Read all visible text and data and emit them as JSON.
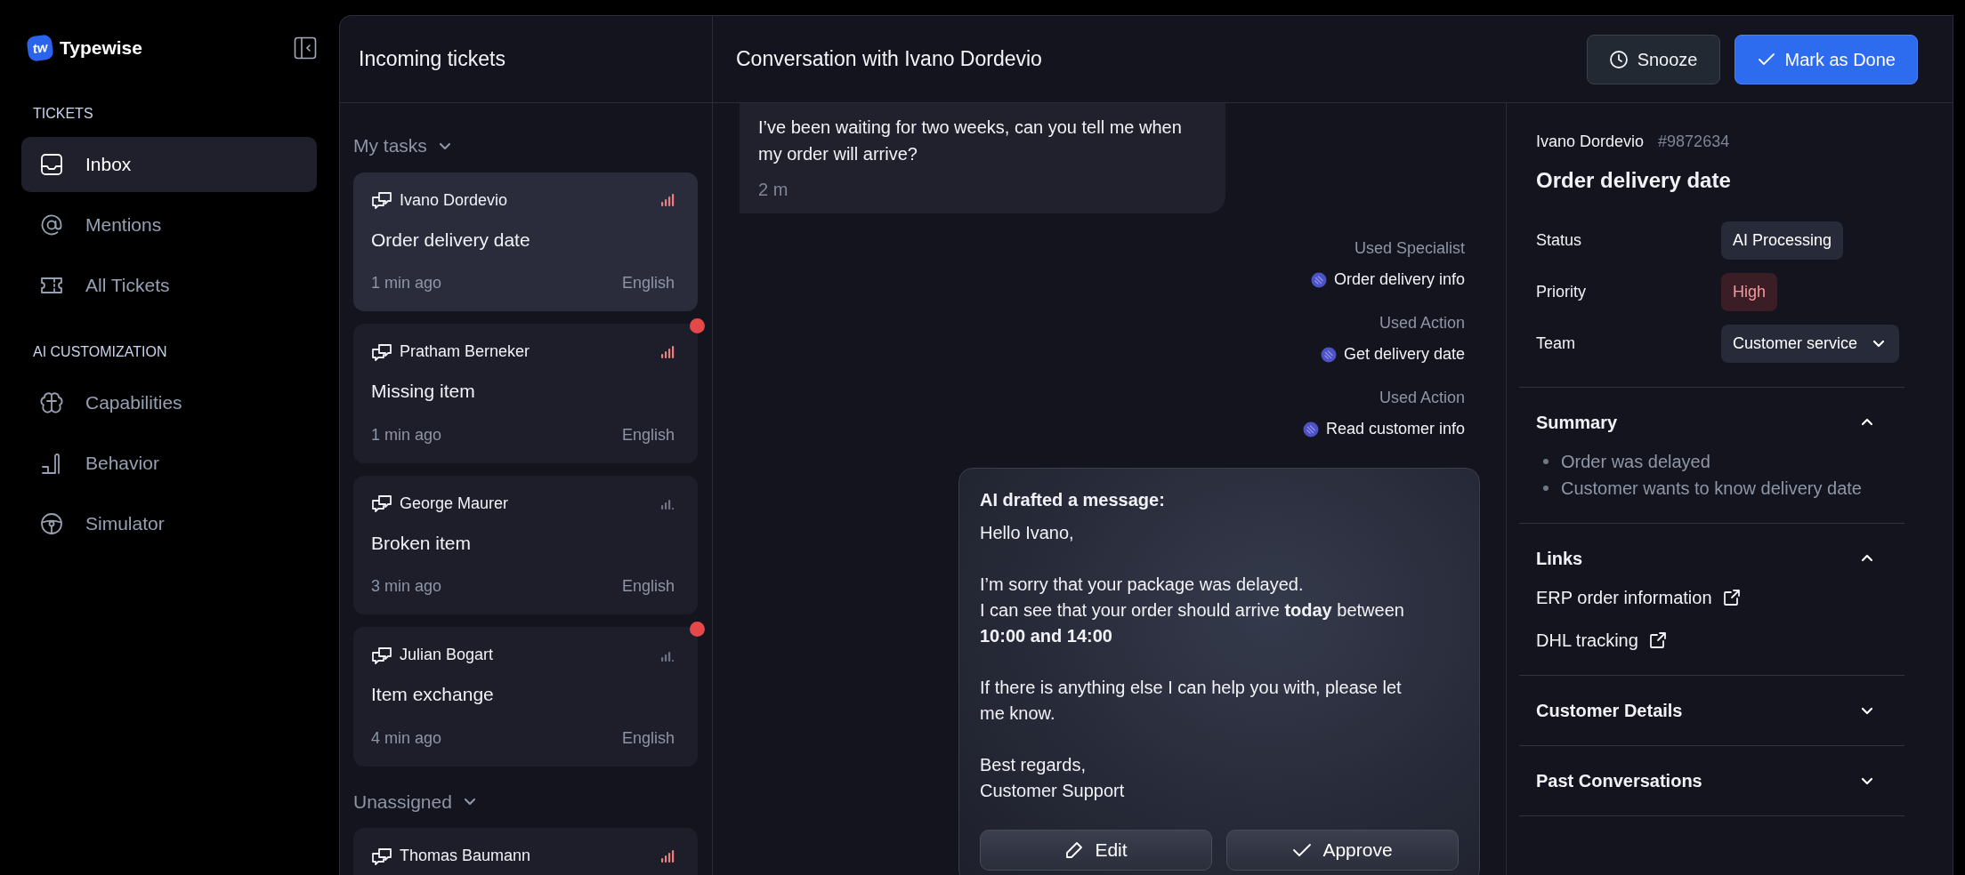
{
  "app": {
    "name": "Typewise",
    "logo_mark": "tw"
  },
  "sidebar": {
    "sections": [
      {
        "title": "TICKETS",
        "items": [
          {
            "label": "Inbox",
            "selected": true
          },
          {
            "label": "Mentions",
            "selected": false
          },
          {
            "label": "All Tickets",
            "selected": false
          }
        ]
      },
      {
        "title": "AI CUSTOMIZATION",
        "items": [
          {
            "label": "Capabilities",
            "selected": false
          },
          {
            "label": "Behavior",
            "selected": false
          },
          {
            "label": "Simulator",
            "selected": false
          }
        ]
      }
    ]
  },
  "ticket_list": {
    "title": "Incoming tickets",
    "groups": [
      {
        "title": "My tasks",
        "tickets": [
          {
            "customer": "Ivano Dordevio",
            "subject": "Order delivery date",
            "time": "1 min ago",
            "language": "English",
            "high_priority": true,
            "selected": true,
            "unread": false
          },
          {
            "customer": "Pratham Berneker",
            "subject": "Missing item",
            "time": "1 min ago",
            "language": "English",
            "high_priority": true,
            "selected": false,
            "unread": true
          },
          {
            "customer": "George Maurer",
            "subject": "Broken item",
            "time": "3 min ago",
            "language": "English",
            "high_priority": false,
            "selected": false,
            "unread": false
          },
          {
            "customer": "Julian Bogart",
            "subject": "Item exchange",
            "time": "4 min ago",
            "language": "English",
            "high_priority": false,
            "selected": false,
            "unread": true
          }
        ]
      },
      {
        "title": "Unassigned",
        "tickets": [
          {
            "customer": "Thomas Baumann",
            "high_priority": true,
            "selected": false,
            "unread": false
          }
        ]
      }
    ]
  },
  "conversation": {
    "title": "Conversation with Ivano Dordevio",
    "buttons": [
      {
        "label": "Snooze",
        "kind": "snooze"
      },
      {
        "label": "Mark as Done",
        "kind": "done"
      }
    ],
    "message": {
      "text": "I’ve been waiting for two weeks, can you tell me when my order will arrive?",
      "time": "2 m"
    },
    "tool_uses": [
      {
        "label": "Used Specialist",
        "name": "Order delivery info"
      },
      {
        "label": "Used Action",
        "name": "Get delivery date"
      },
      {
        "label": "Used Action",
        "name": "Read customer info"
      }
    ],
    "draft": {
      "title": "AI drafted a message:",
      "paragraphs": [
        [
          "Hello Ivano,"
        ],
        [
          "I’m sorry that your package was delayed.",
          "I can see that your order should arrive **today** between **10:00 and 14:00**"
        ],
        [
          "If there is anything else I can help you with, please let me know."
        ],
        [
          "Best regards,",
          "Customer Support"
        ]
      ],
      "buttons": [
        {
          "label": "Edit",
          "kind": "edit"
        },
        {
          "label": "Approve",
          "kind": "approve"
        }
      ]
    }
  },
  "details": {
    "customer": "Ivano Dordevio",
    "ticket_id": "#9872634",
    "subject": "Order delivery date",
    "fields": [
      {
        "label": "Status",
        "value": "AI Processing",
        "kind": "status"
      },
      {
        "label": "Priority",
        "value": "High",
        "kind": "priority"
      },
      {
        "label": "Team",
        "value": "Customer service",
        "kind": "dropdown"
      }
    ],
    "sections": [
      {
        "title": "Summary",
        "expanded": true,
        "bullets": [
          "Order was delayed",
          "Customer wants to know delivery date"
        ]
      },
      {
        "title": "Links",
        "expanded": true,
        "links": [
          "ERP order information",
          "DHL tracking"
        ]
      },
      {
        "title": "Customer Details",
        "expanded": false
      },
      {
        "title": "Past Conversations",
        "expanded": false
      }
    ]
  }
}
